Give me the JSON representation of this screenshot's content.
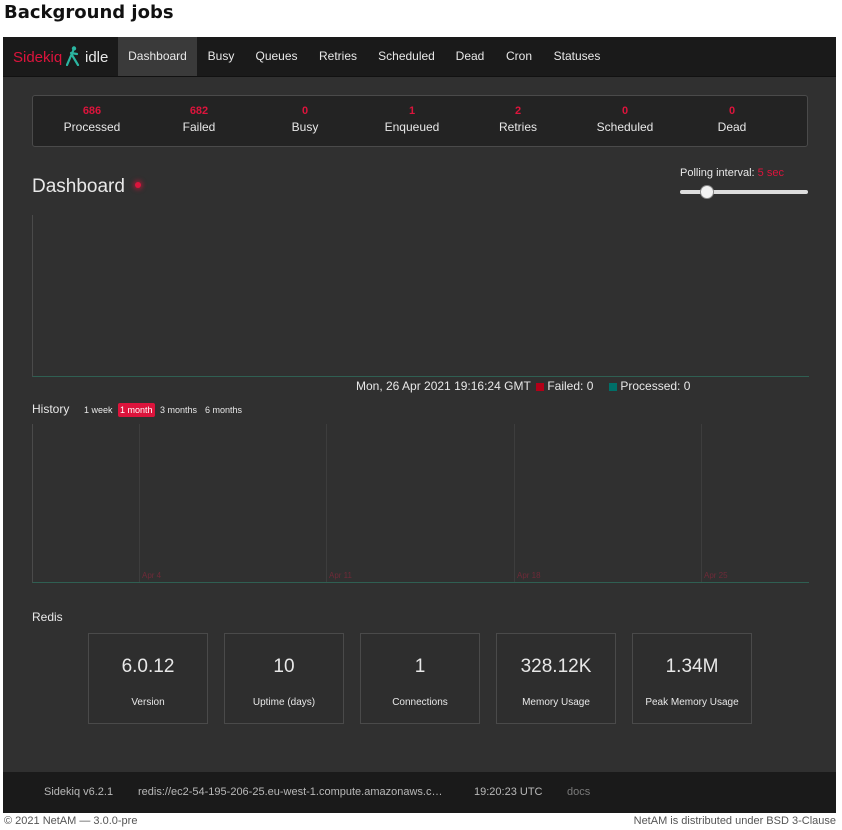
{
  "page": {
    "title": "Background jobs"
  },
  "nav": {
    "brand": "Sidekiq",
    "status": "idle",
    "items": [
      {
        "label": "Dashboard",
        "active": true
      },
      {
        "label": "Busy"
      },
      {
        "label": "Queues"
      },
      {
        "label": "Retries"
      },
      {
        "label": "Scheduled"
      },
      {
        "label": "Dead"
      },
      {
        "label": "Cron"
      },
      {
        "label": "Statuses"
      }
    ]
  },
  "summary": [
    {
      "count": "686",
      "label": "Processed"
    },
    {
      "count": "682",
      "label": "Failed"
    },
    {
      "count": "0",
      "label": "Busy"
    },
    {
      "count": "1",
      "label": "Enqueued"
    },
    {
      "count": "2",
      "label": "Retries"
    },
    {
      "count": "0",
      "label": "Scheduled"
    },
    {
      "count": "0",
      "label": "Dead"
    }
  ],
  "dashboard": {
    "heading": "Dashboard",
    "polling_label": "Polling interval:",
    "polling_value": "5 sec",
    "polling_level": 0.2
  },
  "realtime": {
    "timestamp": "Mon, 26 Apr 2021 19:16:24 GMT",
    "failed_label": "Failed: 0",
    "processed_label": "Processed: 0",
    "failed_color": "#b30018",
    "processed_color": "#006f68"
  },
  "history": {
    "label": "History",
    "ranges": [
      {
        "label": "1 week"
      },
      {
        "label": "1 month",
        "active": true
      },
      {
        "label": "3 months"
      },
      {
        "label": "6 months"
      }
    ],
    "ticks": [
      "Apr 4",
      "Apr 11",
      "Apr 18",
      "Apr 25"
    ]
  },
  "redis": {
    "label": "Redis",
    "cards": [
      {
        "value": "6.0.12",
        "label": "Version"
      },
      {
        "value": "10",
        "label": "Uptime (days)"
      },
      {
        "value": "1",
        "label": "Connections"
      },
      {
        "value": "328.12K",
        "label": "Memory Usage"
      },
      {
        "value": "1.34M",
        "label": "Peak Memory Usage"
      }
    ]
  },
  "footer": {
    "version": "Sidekiq v6.2.1",
    "redis_url": "redis://ec2-54-195-206-25.eu-west-1.compute.amazonaws.c…",
    "time": "19:20:23 UTC",
    "docs": "docs"
  },
  "bottom": {
    "left": "© 2021 NetAM — 3.0.0-pre",
    "right": "NetAM is distributed under BSD 3-Clause"
  },
  "colors": {
    "accent": "#dc143c",
    "background": "#303030",
    "navbar": "#1a1a1a"
  }
}
